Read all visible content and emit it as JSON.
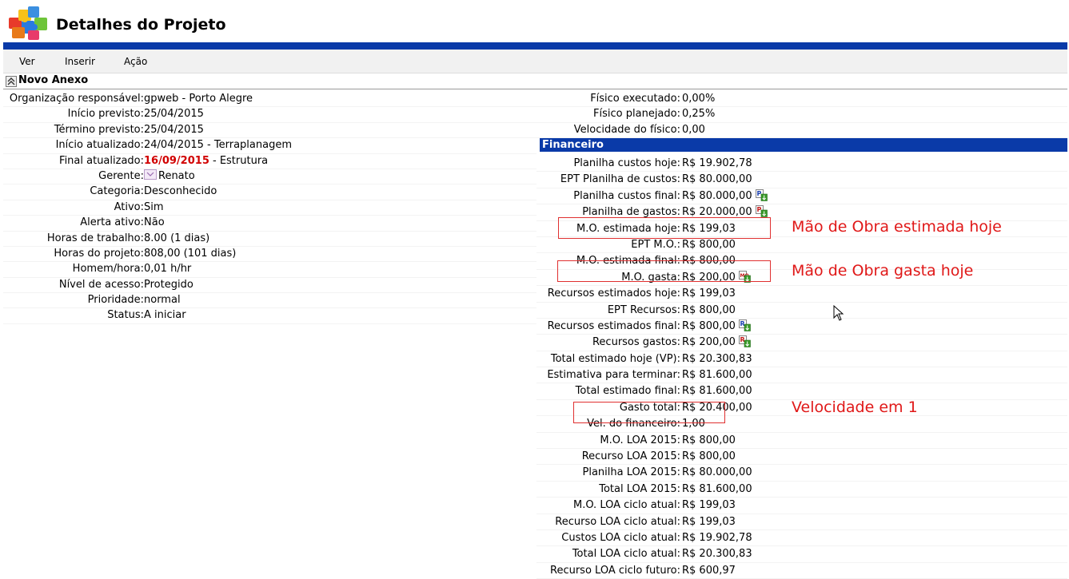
{
  "header": {
    "title": "Detalhes do Projeto"
  },
  "menu": {
    "items": [
      "Ver",
      "Inserir",
      "Ação"
    ]
  },
  "section": {
    "title": "Novo Anexo"
  },
  "left_fields": [
    {
      "label": "Organização responsável:",
      "value": "gpweb - Porto Alegre"
    },
    {
      "label": "Início previsto:",
      "value": "25/04/2015"
    },
    {
      "label": "Término previsto:",
      "value": "25/04/2015"
    },
    {
      "label": "Início atualizado:",
      "value": "24/04/2015 - Terraplanagem"
    },
    {
      "label": "Final atualizado:",
      "value_red": "16/09/2015",
      "value": " - Estrutura"
    },
    {
      "label": "Gerente:",
      "value": "Renato",
      "icon": "user-icon"
    },
    {
      "label": "Categoria:",
      "value": "Desconhecido"
    },
    {
      "label": "Ativo:",
      "value": "Sim"
    },
    {
      "label": "Alerta ativo:",
      "value": "Não"
    },
    {
      "label": "Horas de trabalho:",
      "value": "8.00 (1 dias)"
    },
    {
      "label": "Horas do projeto:",
      "value": "808,00 (101 dias)"
    },
    {
      "label": "Homem/hora:",
      "value": "0,01 h/hr"
    },
    {
      "label": "Nível de acesso:",
      "value": "Protegido"
    },
    {
      "label": "Prioridade:",
      "value": "normal"
    },
    {
      "label": "Status:",
      "value": "A iniciar"
    }
  ],
  "right_fields": [
    {
      "label": "Físico executado:",
      "value": "0,00%"
    },
    {
      "label": "Físico planejado:",
      "value": "0,25%"
    },
    {
      "label": "Velocidade do físico:",
      "value": "0,00"
    }
  ],
  "financeiro": {
    "title": "Financeiro",
    "rows": [
      {
        "label": "Planilha custos hoje:",
        "value": "R$ 19.902,78"
      },
      {
        "label": "EPT Planilha de custos:",
        "value": "R$ 80.000,00"
      },
      {
        "label": "Planilha custos final:",
        "value": "R$ 80.000,00",
        "icon": "planilha-report-icon",
        "icon_letter": "P",
        "icon_color": "#1a3fb0"
      },
      {
        "label": "Planilha de gastos:",
        "value": "R$ 20.000,00",
        "icon": "gastos-report-icon",
        "icon_letter": "P",
        "icon_color": "#c41a1a"
      },
      {
        "label": "M.O. estimada hoje:",
        "value": "R$ 199,03"
      },
      {
        "label": "EPT M.O.:",
        "value": "R$ 800,00"
      },
      {
        "label": "M.O. estimada final:",
        "value": "R$ 800,00"
      },
      {
        "label": "M.O. gasta:",
        "value": "R$ 200,00",
        "icon": "mo-report-icon",
        "icon_letter": "MO",
        "icon_color": "#c41a1a"
      },
      {
        "label": "Recursos estimados hoje:",
        "value": "R$ 199,03"
      },
      {
        "label": "EPT Recursos:",
        "value": "R$ 800,00"
      },
      {
        "label": "Recursos estimados final:",
        "value": "R$ 800,00",
        "icon": "recursos-report-icon",
        "icon_letter": "R",
        "icon_color": "#1a3fb0"
      },
      {
        "label": "Recursos gastos:",
        "value": "R$ 200,00",
        "icon": "recursos-gastos-report-icon",
        "icon_letter": "R",
        "icon_color": "#c41a1a"
      },
      {
        "label": "Total estimado hoje (VP):",
        "value": "R$ 20.300,83"
      },
      {
        "label": "Estimativa para terminar:",
        "value": "R$ 81.600,00"
      },
      {
        "label": "Total estimado final:",
        "value": "R$ 81.600,00"
      },
      {
        "label": "Gasto total:",
        "value": "R$ 20.400,00"
      },
      {
        "label": "Vel. do financeiro:",
        "value": "1,00"
      },
      {
        "label": "M.O. LOA 2015:",
        "value": "R$ 800,00"
      },
      {
        "label": "Recurso LOA 2015:",
        "value": "R$ 800,00"
      },
      {
        "label": "Planilha LOA 2015:",
        "value": "R$ 80.000,00"
      },
      {
        "label": "Total LOA 2015:",
        "value": "R$ 81.600,00"
      },
      {
        "label": "M.O. LOA ciclo atual:",
        "value": "R$ 199,03"
      },
      {
        "label": "Recurso LOA ciclo atual:",
        "value": "R$ 199,03"
      },
      {
        "label": "Custos LOA ciclo atual:",
        "value": "R$ 19.902,78"
      },
      {
        "label": "Total LOA ciclo atual:",
        "value": "R$ 20.300,83"
      },
      {
        "label": "Recurso LOA ciclo futuro:",
        "value": "R$ 600,97"
      }
    ]
  },
  "annotations": {
    "mo_estimada": "Mão de Obra estimada hoje",
    "mo_gasta": "Mão de Obra gasta hoje",
    "velocidade": "Velocidade em 1"
  },
  "colors": {
    "brand_blue": "#0a3aa8",
    "annotation_red": "#e01818",
    "date_red": "#d10000"
  }
}
